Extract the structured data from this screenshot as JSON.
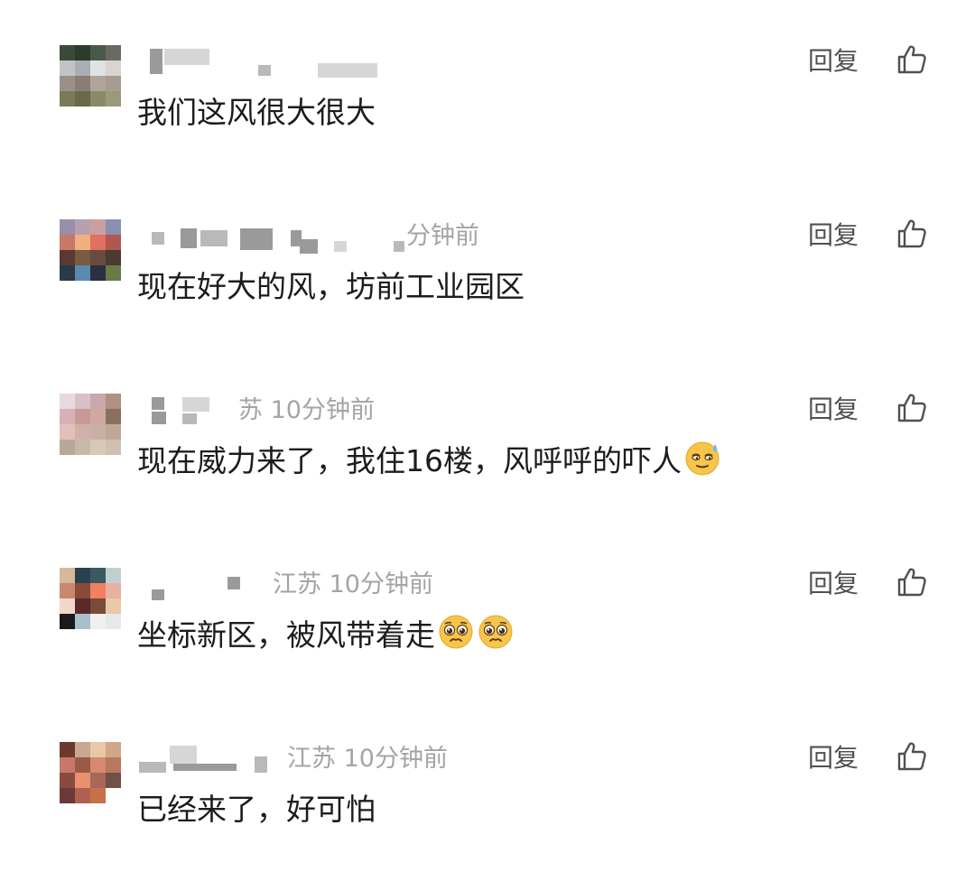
{
  "actions": {
    "reply_label": "回复"
  },
  "comments": [
    {
      "meta": "",
      "text": "我们这风很大很大",
      "emojis": []
    },
    {
      "meta": "分钟前",
      "text": "现在好大的风，坊前工业园区",
      "emojis": []
    },
    {
      "meta": "苏 10分钟前",
      "text": "现在威力来了，我住16楼，风呼呼的吓人",
      "emojis": [
        "sweat-face"
      ]
    },
    {
      "meta": "江苏 10分钟前",
      "text": "坐标新区，被风带着走",
      "emojis": [
        "pleading-face",
        "pleading-face"
      ]
    },
    {
      "meta": "江苏 10分钟前",
      "text": "已经来了，好可怕",
      "emojis": []
    }
  ],
  "avatars": [
    [
      "#3a4a38",
      "#2e3a2c",
      "#4a5a48",
      "#6a6a60",
      "#c0c4c8",
      "#a8aeb4",
      "#e0e2e4",
      "#d8d4d0",
      "#9a9088",
      "#8a7e74",
      "#b0a498",
      "#a89c90",
      "#7a7a5a",
      "#6a6a4a",
      "#8a8a6a",
      "#9a9a7a"
    ],
    [
      "#9a8ea8",
      "#b8a0b0",
      "#c8a0a0",
      "#8a90b0",
      "#c87868",
      "#f0b080",
      "#e07060",
      "#b05850",
      "#5a3a30",
      "#7a5a40",
      "#6a4a40",
      "#4a3a30",
      "#2a3a48",
      "#5a8ab0",
      "#2a3040",
      "#6a7a4a"
    ],
    [
      "#e8d8e0",
      "#d8c0c8",
      "#c8a8a8",
      "#b09080",
      "#d8b0b8",
      "#c89898",
      "#d0a8a0",
      "#8a7060",
      "#e0c0b8",
      "#d0b0a8",
      "#c8b0a8",
      "#c0a898",
      "#b8a898",
      "#c8b8a8",
      "#d8c8b8",
      "#d0c0b0"
    ],
    [
      "#d8b898",
      "#2a4050",
      "#3a5a60",
      "#c0d0d0",
      "#c88870",
      "#8a4a3a",
      "#f08060",
      "#e8b0a0",
      "#f0d8c8",
      "#5a2a2a",
      "#7a4a3a",
      "#e8c8a8",
      "#1a1a1a",
      "#a8c0c8",
      "#f0f0f0",
      "#e8e8e8"
    ],
    [
      "#6a3a30",
      "#c8a890",
      "#e8c8a8",
      "#d0a888",
      "#c87868",
      "#9a5a48",
      "#d88870",
      "#b87860",
      "#8a4a40",
      "#e89070",
      "#a86858",
      "#705048",
      "#6a3a38",
      "#b06050",
      "#c87048",
      "#ffffff"
    ]
  ]
}
